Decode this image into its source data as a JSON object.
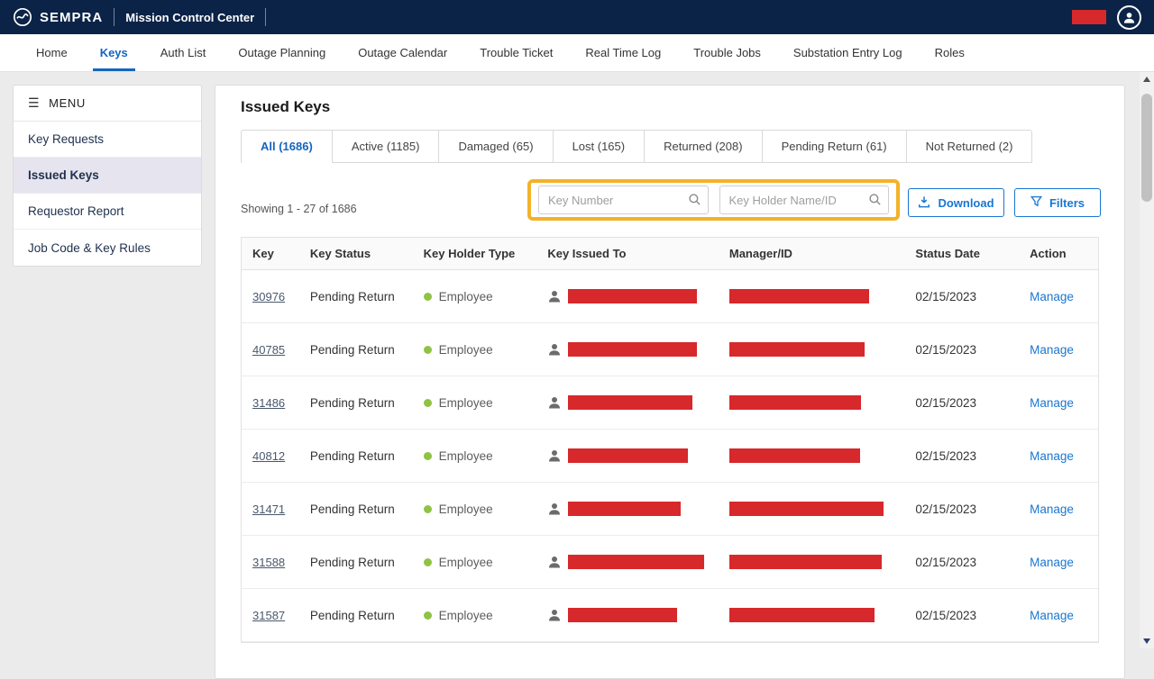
{
  "header": {
    "brand": "SEMPRA",
    "title": "Mission Control Center"
  },
  "nav": {
    "items": [
      {
        "label": "Home",
        "active": false
      },
      {
        "label": "Keys",
        "active": true
      },
      {
        "label": "Auth List",
        "active": false
      },
      {
        "label": "Outage Planning",
        "active": false
      },
      {
        "label": "Outage Calendar",
        "active": false
      },
      {
        "label": "Trouble Ticket",
        "active": false
      },
      {
        "label": "Real Time Log",
        "active": false
      },
      {
        "label": "Trouble Jobs",
        "active": false
      },
      {
        "label": "Substation Entry Log",
        "active": false
      },
      {
        "label": "Roles",
        "active": false
      }
    ]
  },
  "sidebar": {
    "menu_label": "MENU",
    "items": [
      {
        "label": "Key Requests",
        "selected": false
      },
      {
        "label": "Issued Keys",
        "selected": true
      },
      {
        "label": "Requestor Report",
        "selected": false
      },
      {
        "label": "Job Code & Key Rules",
        "selected": false
      }
    ]
  },
  "main": {
    "title": "Issued Keys",
    "tabs": [
      {
        "label": "All (1686)",
        "active": true
      },
      {
        "label": "Active (1185)",
        "active": false
      },
      {
        "label": "Damaged (65)",
        "active": false
      },
      {
        "label": "Lost (165)",
        "active": false
      },
      {
        "label": "Returned (208)",
        "active": false
      },
      {
        "label": "Pending Return (61)",
        "active": false
      },
      {
        "label": "Not Returned (2)",
        "active": false
      }
    ],
    "showing_text": "Showing 1 - 27 of 1686",
    "search": {
      "key_number_placeholder": "Key Number",
      "key_holder_placeholder": "Key Holder Name/ID"
    },
    "buttons": {
      "download": "Download",
      "filters": "Filters"
    },
    "table": {
      "columns": [
        "Key",
        "Key Status",
        "Key Holder Type",
        "Key Issued To",
        "Manager/ID",
        "Status Date",
        "Action"
      ],
      "rows": [
        {
          "key": "30976",
          "status": "Pending Return",
          "holder_type": "Employee",
          "status_date": "02/15/2023",
          "action": "Manage",
          "issued_bar_w": 143,
          "manager_bar_w": 155
        },
        {
          "key": "40785",
          "status": "Pending Return",
          "holder_type": "Employee",
          "status_date": "02/15/2023",
          "action": "Manage",
          "issued_bar_w": 143,
          "manager_bar_w": 150
        },
        {
          "key": "31486",
          "status": "Pending Return",
          "holder_type": "Employee",
          "status_date": "02/15/2023",
          "action": "Manage",
          "issued_bar_w": 138,
          "manager_bar_w": 146
        },
        {
          "key": "40812",
          "status": "Pending Return",
          "holder_type": "Employee",
          "status_date": "02/15/2023",
          "action": "Manage",
          "issued_bar_w": 133,
          "manager_bar_w": 145
        },
        {
          "key": "31471",
          "status": "Pending Return",
          "holder_type": "Employee",
          "status_date": "02/15/2023",
          "action": "Manage",
          "issued_bar_w": 125,
          "manager_bar_w": 171
        },
        {
          "key": "31588",
          "status": "Pending Return",
          "holder_type": "Employee",
          "status_date": "02/15/2023",
          "action": "Manage",
          "issued_bar_w": 151,
          "manager_bar_w": 169
        },
        {
          "key": "31587",
          "status": "Pending Return",
          "holder_type": "Employee",
          "status_date": "02/15/2023",
          "action": "Manage",
          "issued_bar_w": 121,
          "manager_bar_w": 161
        }
      ]
    }
  },
  "colors": {
    "header_bg": "#0b2347",
    "accent_blue": "#1565c0",
    "link_blue": "#1976d2",
    "redaction": "#d7282c",
    "highlight_yellow": "#f3b229",
    "employee_dot": "#8fc344"
  }
}
